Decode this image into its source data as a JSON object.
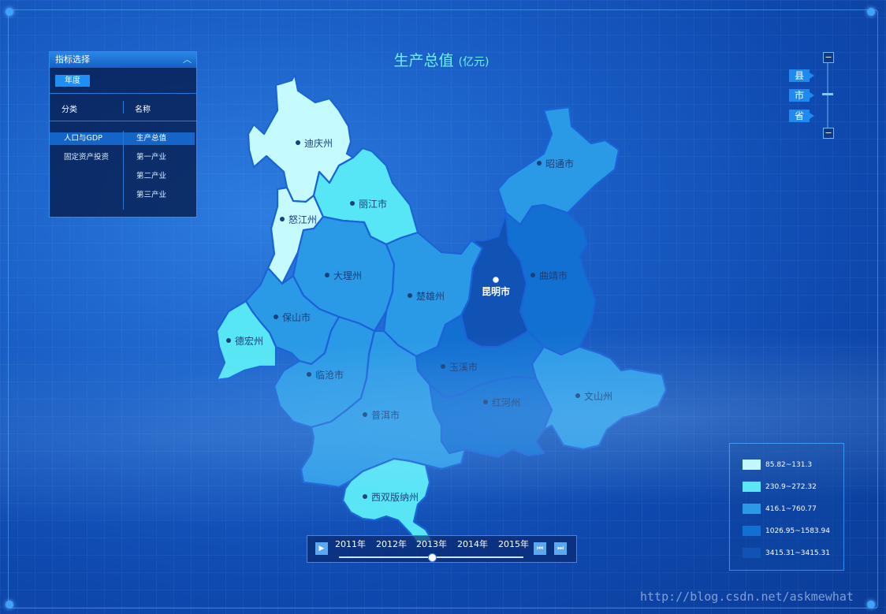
{
  "title": {
    "main": "生产总值",
    "unit": "(亿元)"
  },
  "indicator_panel": {
    "header": "指标选择",
    "year_button": "年度",
    "col_category": "分类",
    "col_name": "名称",
    "categories": [
      "人口与GDP",
      "固定资产投资"
    ],
    "names": [
      "生产总值",
      "第一产业",
      "第二产业",
      "第三产业"
    ],
    "selected_category": "人口与GDP",
    "selected_name": "生产总值"
  },
  "levels": [
    "县",
    "市",
    "省"
  ],
  "legend": [
    {
      "label": "85.82~131.3",
      "color": "#c5fbff"
    },
    {
      "label": "230.9~272.32",
      "color": "#57e6f5"
    },
    {
      "label": "416.1~760.77",
      "color": "#2b9ae6"
    },
    {
      "label": "1026.95~1583.94",
      "color": "#1270d2"
    },
    {
      "label": "3415.31~3415.31",
      "color": "#1152b5"
    }
  ],
  "regions": [
    {
      "name": "迪庆州",
      "class": 0
    },
    {
      "name": "怒江州",
      "class": 0
    },
    {
      "name": "丽江市",
      "class": 1
    },
    {
      "name": "德宏州",
      "class": 1
    },
    {
      "name": "西双版纳州",
      "class": 1
    },
    {
      "name": "昭通市",
      "class": 2
    },
    {
      "name": "大理州",
      "class": 2
    },
    {
      "name": "保山市",
      "class": 2
    },
    {
      "name": "楚雄州",
      "class": 2
    },
    {
      "name": "临沧市",
      "class": 2
    },
    {
      "name": "普洱市",
      "class": 2
    },
    {
      "name": "文山州",
      "class": 2
    },
    {
      "name": "曲靖市",
      "class": 3
    },
    {
      "name": "玉溪市",
      "class": 3
    },
    {
      "name": "红河州",
      "class": 3
    },
    {
      "name": "昆明市",
      "class": 4
    }
  ],
  "timeline": {
    "years": [
      "2011年",
      "2012年",
      "2013年",
      "2014年",
      "2015年"
    ],
    "current": "2013年"
  },
  "watermark": "http://blog.csdn.net/askmewhat"
}
